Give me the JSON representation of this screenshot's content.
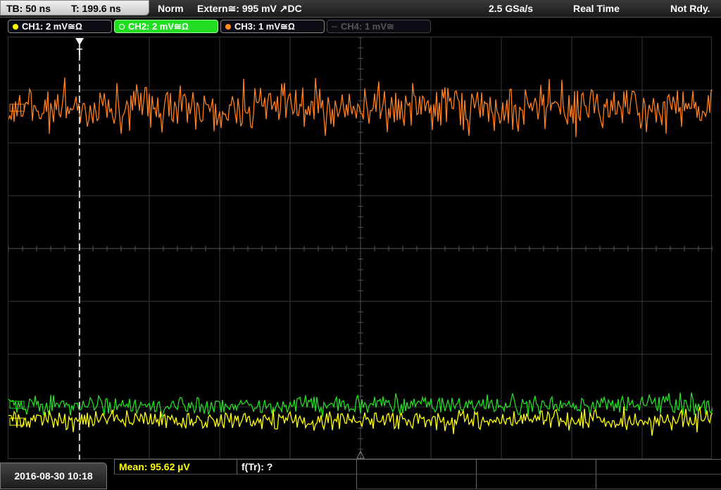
{
  "header": {
    "timebase": "TB: 50 ns",
    "trigger_time": "T: 199.6 ns",
    "trigger_mode": "Norm",
    "trigger_source": "Extern≅: 995 mV ↗DC",
    "sample_rate": "2.5 GSa/s",
    "acq_mode": "Real Time",
    "status": "Not Rdy."
  },
  "channels": [
    {
      "label": "CH1: 2 mV≅Ω",
      "color": "#ffff00",
      "state": "on"
    },
    {
      "label": "CH2: 2 mV≅Ω",
      "color": "#22ee22",
      "state": "selected"
    },
    {
      "label": "CH3: 1 mV≅Ω",
      "color": "#ff8c1a",
      "state": "on"
    },
    {
      "label": "CH4: 1 mV≅",
      "color": "#555555",
      "state": "off"
    }
  ],
  "traces": {
    "ch3_color": "#ff7f1a",
    "ch2_color": "#22dd22",
    "ch1_color": "#ffff00"
  },
  "trigger_marker": "T",
  "footer": {
    "datetime": "2016-08-30 10:18",
    "measurement_1": "Mean: 95.62 µV",
    "measurement_2": "f(Tr): ?"
  }
}
